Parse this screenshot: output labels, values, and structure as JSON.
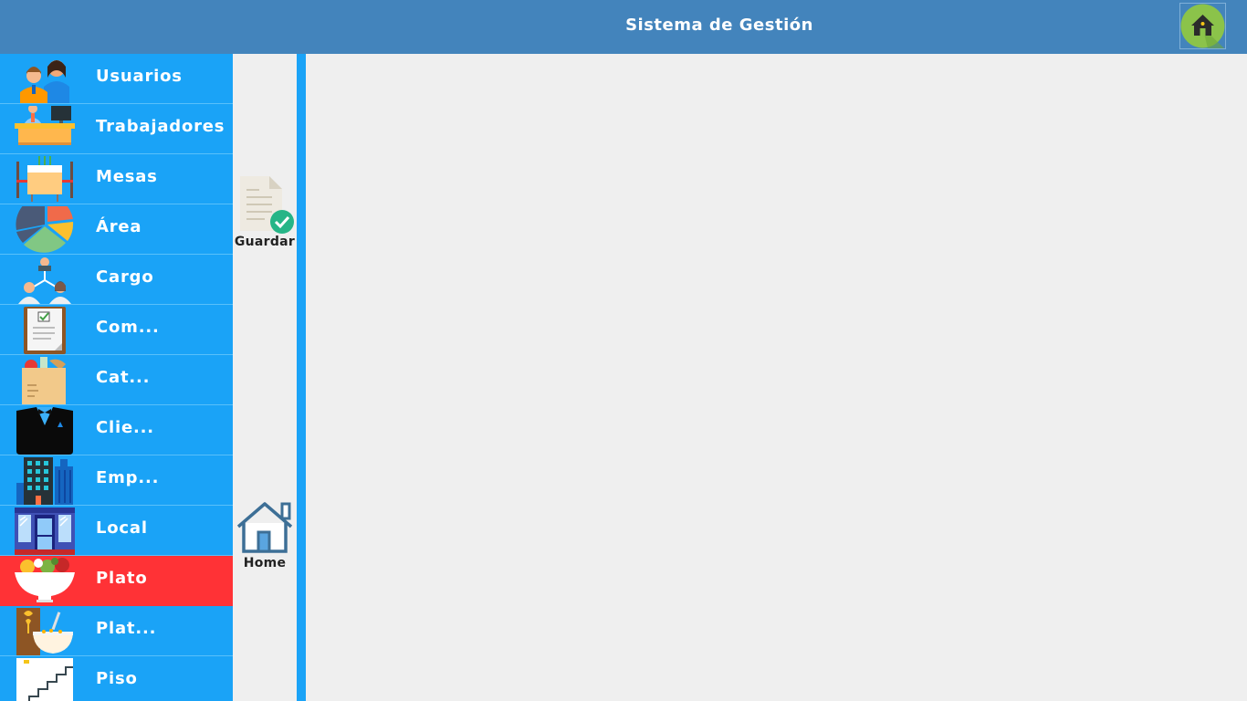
{
  "header": {
    "title": "Sistema de Gestión",
    "home_icon": "home-icon"
  },
  "sidebar": {
    "items": [
      {
        "label": "Usuarios",
        "icon": "users-icon"
      },
      {
        "label": "Trabajadores",
        "icon": "desk-worker-icon"
      },
      {
        "label": "Mesas",
        "icon": "dining-table-icon"
      },
      {
        "label": "Área",
        "icon": "pie-chart-icon"
      },
      {
        "label": "Cargo",
        "icon": "org-chart-icon"
      },
      {
        "label": "Com...",
        "icon": "clipboard-icon"
      },
      {
        "label": "Cat...",
        "icon": "grocery-bag-icon"
      },
      {
        "label": "Clie...",
        "icon": "tuxedo-icon"
      },
      {
        "label": "Emp...",
        "icon": "buildings-icon"
      },
      {
        "label": "Local",
        "icon": "storefront-icon"
      },
      {
        "label": "Plato",
        "icon": "salad-bowl-icon",
        "active": true
      },
      {
        "label": "Plat...",
        "icon": "cereal-bowl-icon"
      },
      {
        "label": "Piso",
        "icon": "stairs-icon"
      }
    ]
  },
  "toolbar": {
    "save_label": "Guardar",
    "home_label": "Home"
  },
  "colors": {
    "header": "#4384bc",
    "sidebar": "#1aa3f7",
    "active": "#ff3236",
    "content": "#efefef"
  }
}
